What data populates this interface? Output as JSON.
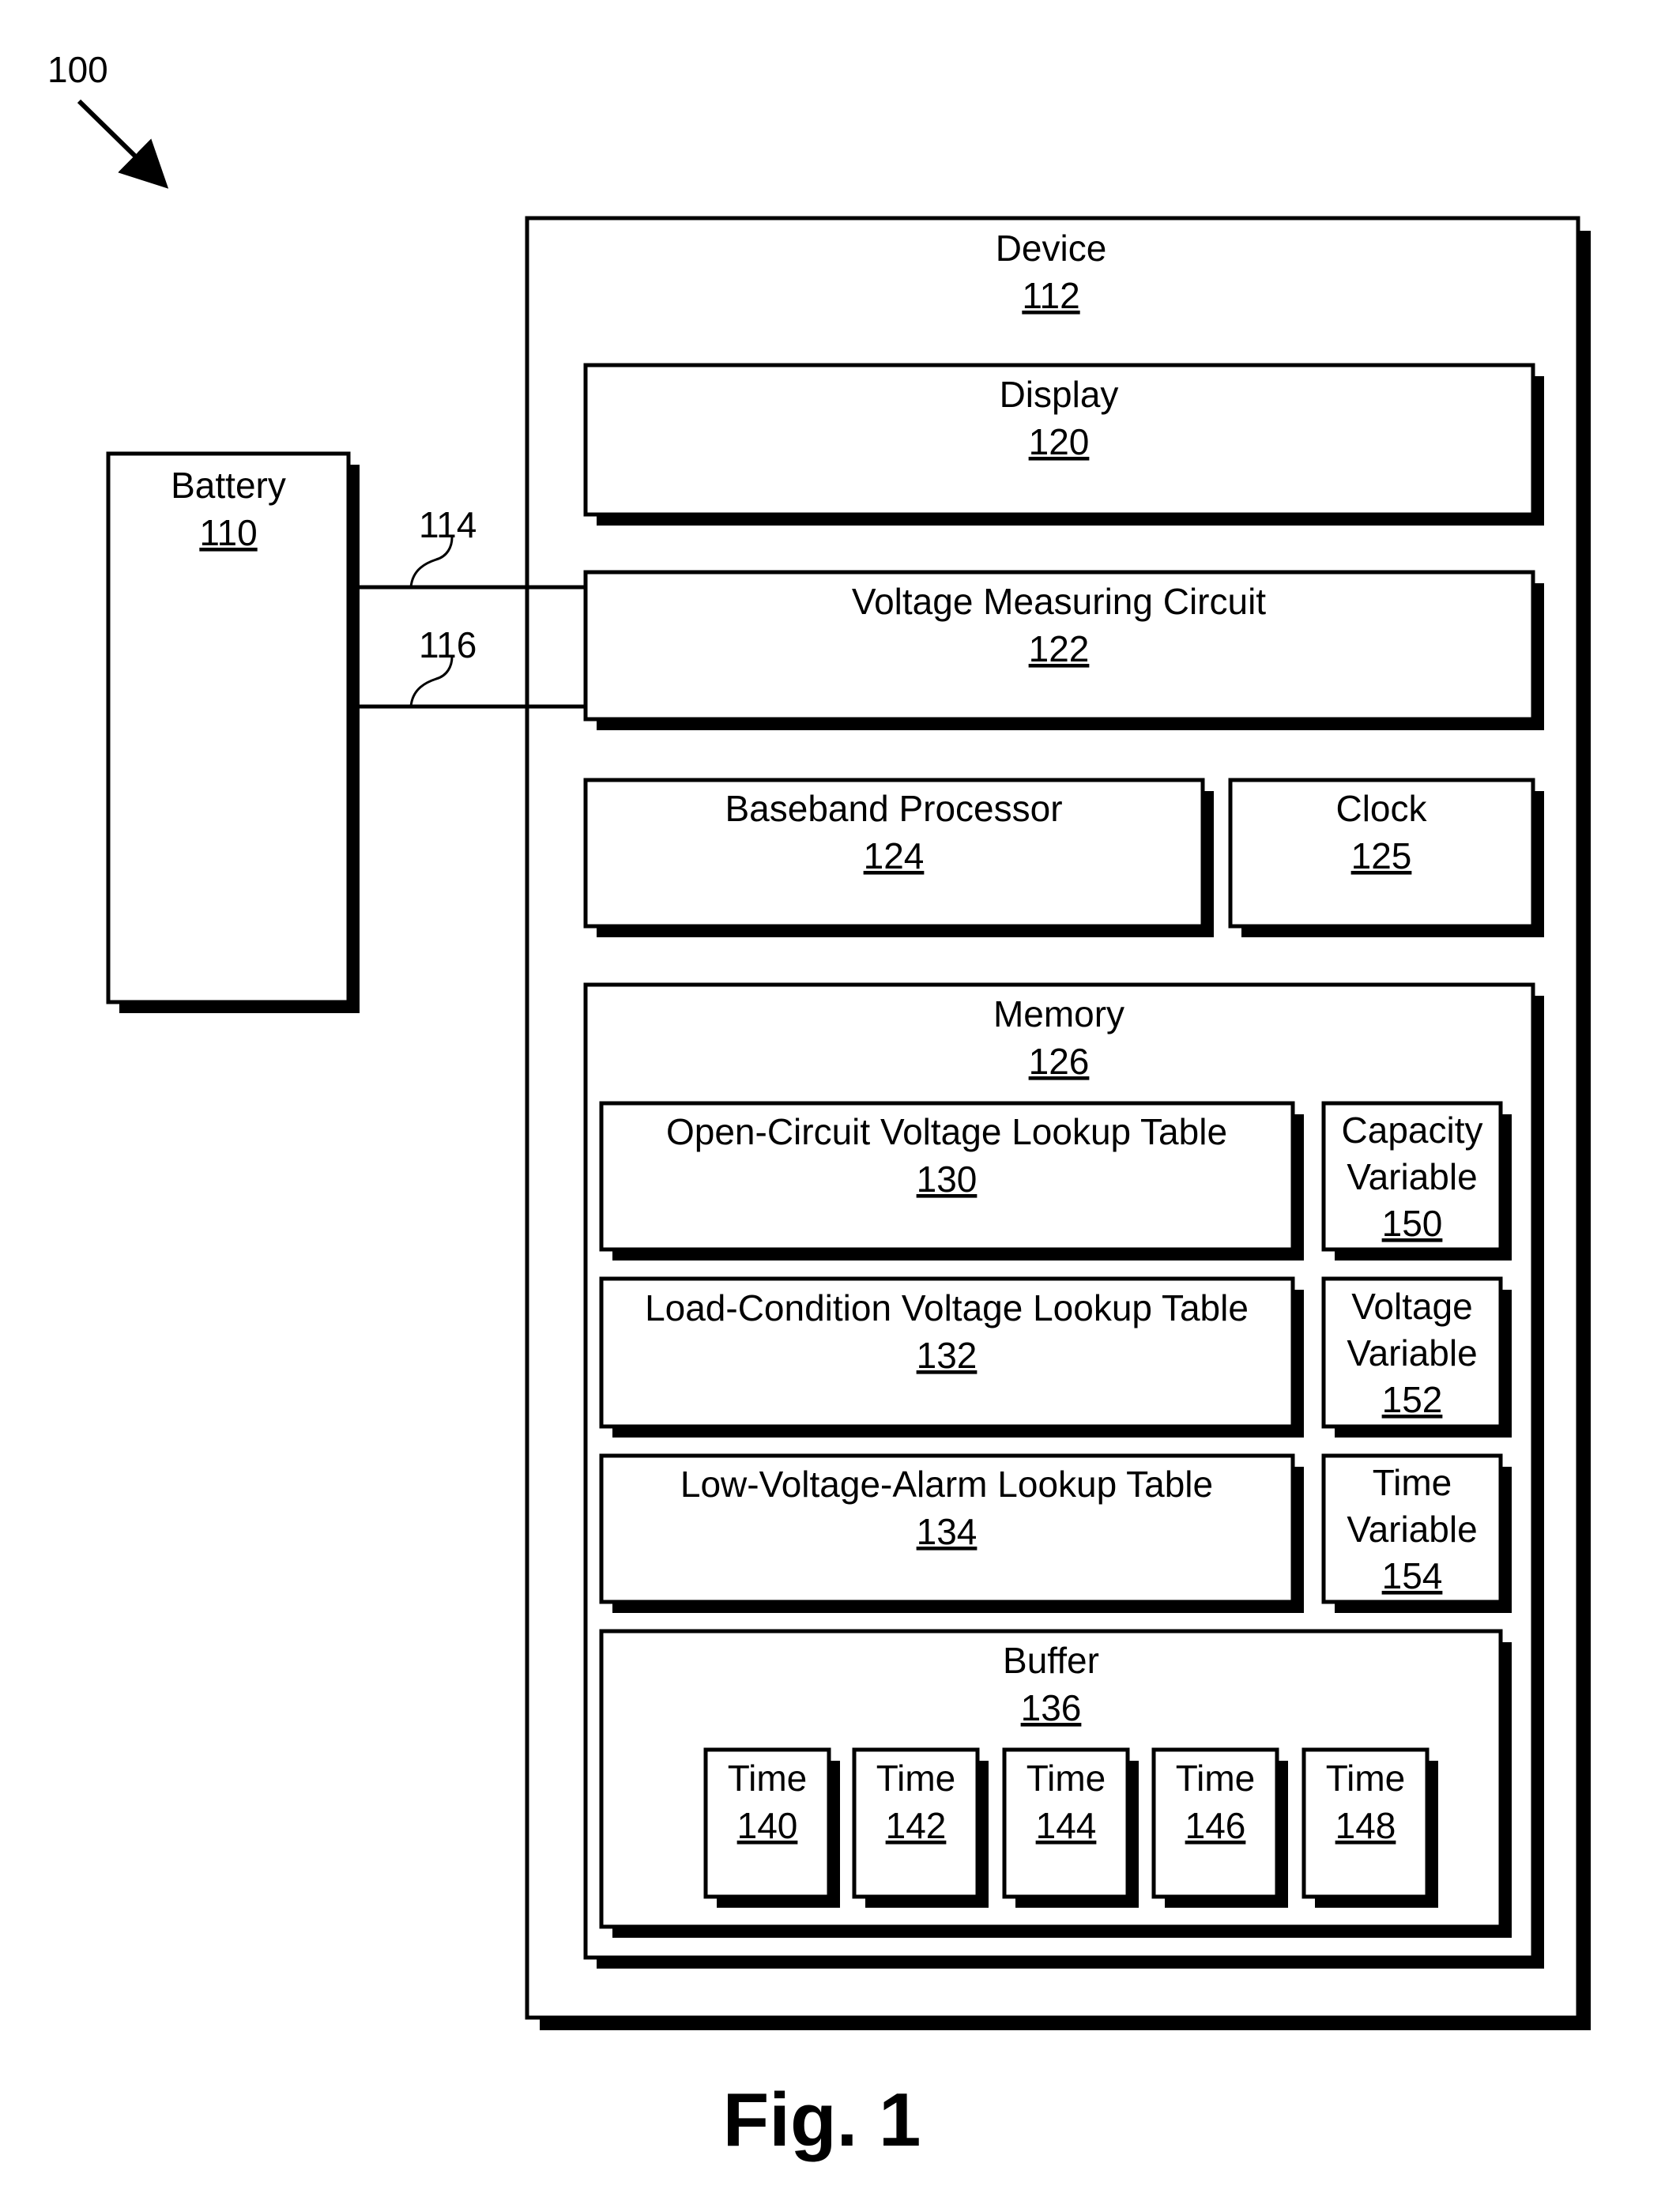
{
  "figure": {
    "reference": "100",
    "caption": "Fig. 1"
  },
  "battery": {
    "label": "Battery",
    "number": "110"
  },
  "connections": [
    {
      "number": "114"
    },
    {
      "number": "116"
    }
  ],
  "device": {
    "label": "Device",
    "number": "112",
    "components": {
      "display": {
        "label": "Display",
        "number": "120"
      },
      "voltage_measuring_circuit": {
        "label": "Voltage Measuring Circuit",
        "number": "122"
      },
      "baseband_processor": {
        "label": "Baseband Processor",
        "number": "124"
      },
      "clock": {
        "label": "Clock",
        "number": "125"
      },
      "memory": {
        "label": "Memory",
        "number": "126",
        "tables": [
          {
            "label": "Open-Circuit Voltage Lookup Table",
            "number": "130"
          },
          {
            "label": "Load-Condition Voltage Lookup Table",
            "number": "132"
          },
          {
            "label": "Low-Voltage-Alarm Lookup Table",
            "number": "134"
          }
        ],
        "variables": [
          {
            "line1": "Capacity",
            "line2": "Variable",
            "number": "150"
          },
          {
            "line1": "Voltage",
            "line2": "Variable",
            "number": "152"
          },
          {
            "line1": "Time",
            "line2": "Variable",
            "number": "154"
          }
        ],
        "buffer": {
          "label": "Buffer",
          "number": "136",
          "entries": [
            {
              "label": "Time",
              "number": "140"
            },
            {
              "label": "Time",
              "number": "142"
            },
            {
              "label": "Time",
              "number": "144"
            },
            {
              "label": "Time",
              "number": "146"
            },
            {
              "label": "Time",
              "number": "148"
            }
          ]
        }
      }
    }
  }
}
